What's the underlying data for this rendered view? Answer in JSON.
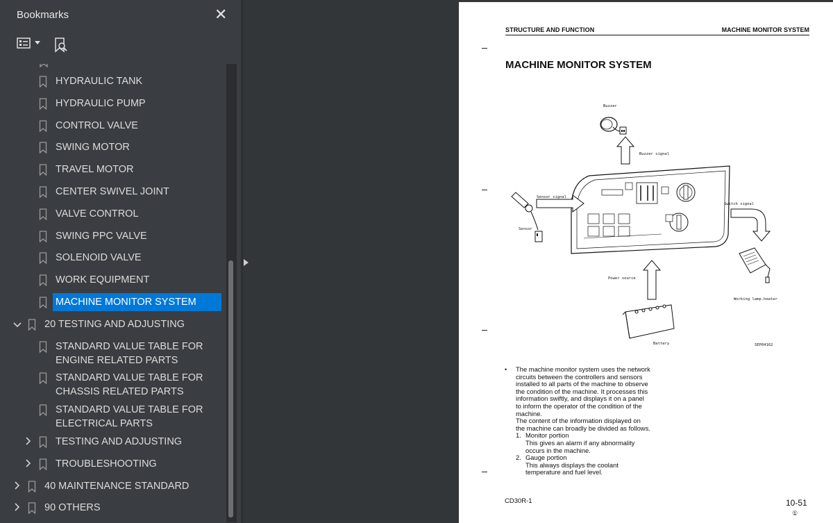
{
  "sidebar": {
    "title": "Bookmarks",
    "close_label": "✕",
    "options_icon": "list-options-icon",
    "find_icon": "bookmark-search-icon",
    "items": [
      {
        "label": "HYDRAULIC TANK",
        "level": 2,
        "expander": null,
        "selected": false
      },
      {
        "label": "HYDRAULIC PUMP",
        "level": 2,
        "expander": null,
        "selected": false
      },
      {
        "label": "CONTROL VALVE",
        "level": 2,
        "expander": null,
        "selected": false
      },
      {
        "label": "SWING MOTOR",
        "level": 2,
        "expander": null,
        "selected": false
      },
      {
        "label": "TRAVEL MOTOR",
        "level": 2,
        "expander": null,
        "selected": false
      },
      {
        "label": "CENTER SWIVEL JOINT",
        "level": 2,
        "expander": null,
        "selected": false
      },
      {
        "label": "VALVE CONTROL",
        "level": 2,
        "expander": null,
        "selected": false
      },
      {
        "label": "SWING PPC VALVE",
        "level": 2,
        "expander": null,
        "selected": false
      },
      {
        "label": "SOLENOID VALVE",
        "level": 2,
        "expander": null,
        "selected": false
      },
      {
        "label": "WORK EQUIPMENT",
        "level": 2,
        "expander": null,
        "selected": false
      },
      {
        "label": "MACHINE MONITOR SYSTEM",
        "level": 2,
        "expander": null,
        "selected": true
      },
      {
        "label": "20 TESTING AND ADJUSTING",
        "level": 1,
        "expander": "expanded",
        "selected": false
      },
      {
        "label": "STANDARD VALUE TABLE FOR",
        "label2": "ENGINE RELATED PARTS",
        "level": 2,
        "expander": null,
        "selected": false
      },
      {
        "label": "STANDARD VALUE TABLE FOR",
        "label2": "CHASSIS RELATED PARTS",
        "level": 2,
        "expander": null,
        "selected": false
      },
      {
        "label": "STANDARD VALUE TABLE FOR",
        "label2": "ELECTRICAL PARTS",
        "level": 2,
        "expander": null,
        "selected": false
      },
      {
        "label": "TESTING AND ADJUSTING",
        "level": 2,
        "expander": "collapsed",
        "selected": false
      },
      {
        "label": "TROUBLESHOOTING",
        "level": 2,
        "expander": "collapsed",
        "selected": false
      },
      {
        "label": "40 MAINTENANCE STANDARD",
        "level": 1,
        "expander": "collapsed",
        "selected": false
      },
      {
        "label": "90 OTHERS",
        "level": 1,
        "expander": "collapsed",
        "selected": false
      }
    ]
  },
  "page": {
    "header_left": "STRUCTURE AND FUNCTION",
    "header_right": "MACHINE MONITOR SYSTEM",
    "title": "MACHINE MONITOR SYSTEM",
    "diagram": {
      "buzzer": "Buzzer",
      "buzzer_signal": "Buzzer signal",
      "sensor_signal": "Sensor signal",
      "sensor": "Sensor",
      "switch_signal": "Switch signal",
      "power_source": "Power source",
      "battery": "Battery",
      "working_lamp": "Working lamp.heater",
      "code": "SEP04162"
    },
    "bullet": "•",
    "paragraph1": "The machine monitor system uses the network circuits between the controllers and sensors installed to all parts of the machine to observe the condition of the machine. It processes this information swiftly, and displays it on a panel to inform the operator of the condition of the machine.",
    "paragraph2": "The content of the information displayed on the machine can broadly be divided as follows.",
    "list": [
      {
        "num": "1.",
        "title": "Monitor portion",
        "text": "This gives an alarm if any abnormality occurs in the machine."
      },
      {
        "num": "2.",
        "title": "Gauge portion",
        "text": "This always displays the coolant temperature and fuel level."
      }
    ],
    "footer_model": "CD30R-1",
    "footer_page": "10-51",
    "footer_circle": "①"
  }
}
